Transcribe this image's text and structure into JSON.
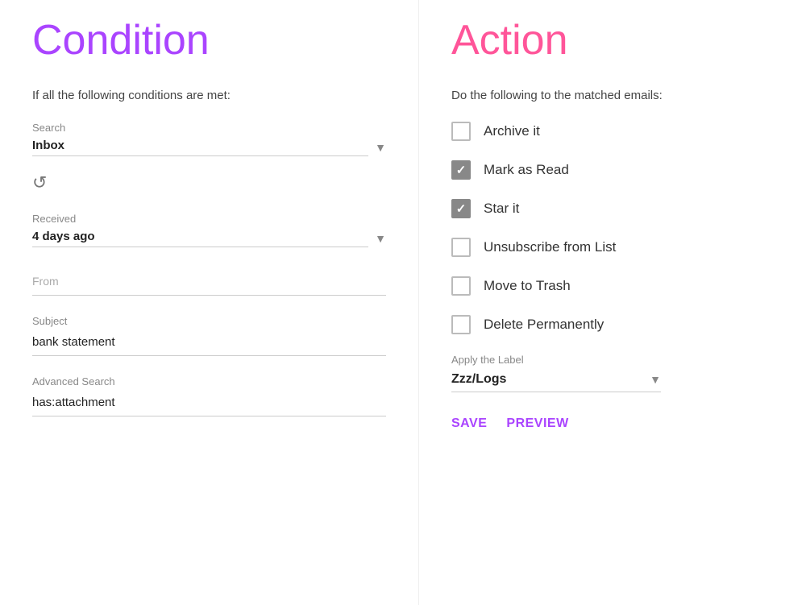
{
  "condition": {
    "title": "Condition",
    "subtitle": "If all the following conditions are met:",
    "search_label": "Search",
    "search_value": "Inbox",
    "received_label": "Received",
    "received_value": "4 days ago",
    "from_placeholder": "From",
    "subject_label": "Subject",
    "subject_value": "bank statement",
    "advanced_label": "Advanced Search",
    "advanced_value": "has:attachment"
  },
  "action": {
    "title": "Action",
    "subtitle": "Do the following to the matched emails:",
    "checkboxes": [
      {
        "id": "archive",
        "label": "Archive it",
        "checked": false
      },
      {
        "id": "mark-read",
        "label": "Mark as Read",
        "checked": true
      },
      {
        "id": "star",
        "label": "Star it",
        "checked": true
      },
      {
        "id": "unsubscribe",
        "label": "Unsubscribe from List",
        "checked": false
      },
      {
        "id": "trash",
        "label": "Move to Trash",
        "checked": false
      },
      {
        "id": "delete",
        "label": "Delete Permanently",
        "checked": false
      }
    ],
    "apply_label_text": "Apply the Label",
    "apply_label_value": "Zzz/Logs",
    "save_label": "SAVE",
    "preview_label": "PREVIEW"
  }
}
